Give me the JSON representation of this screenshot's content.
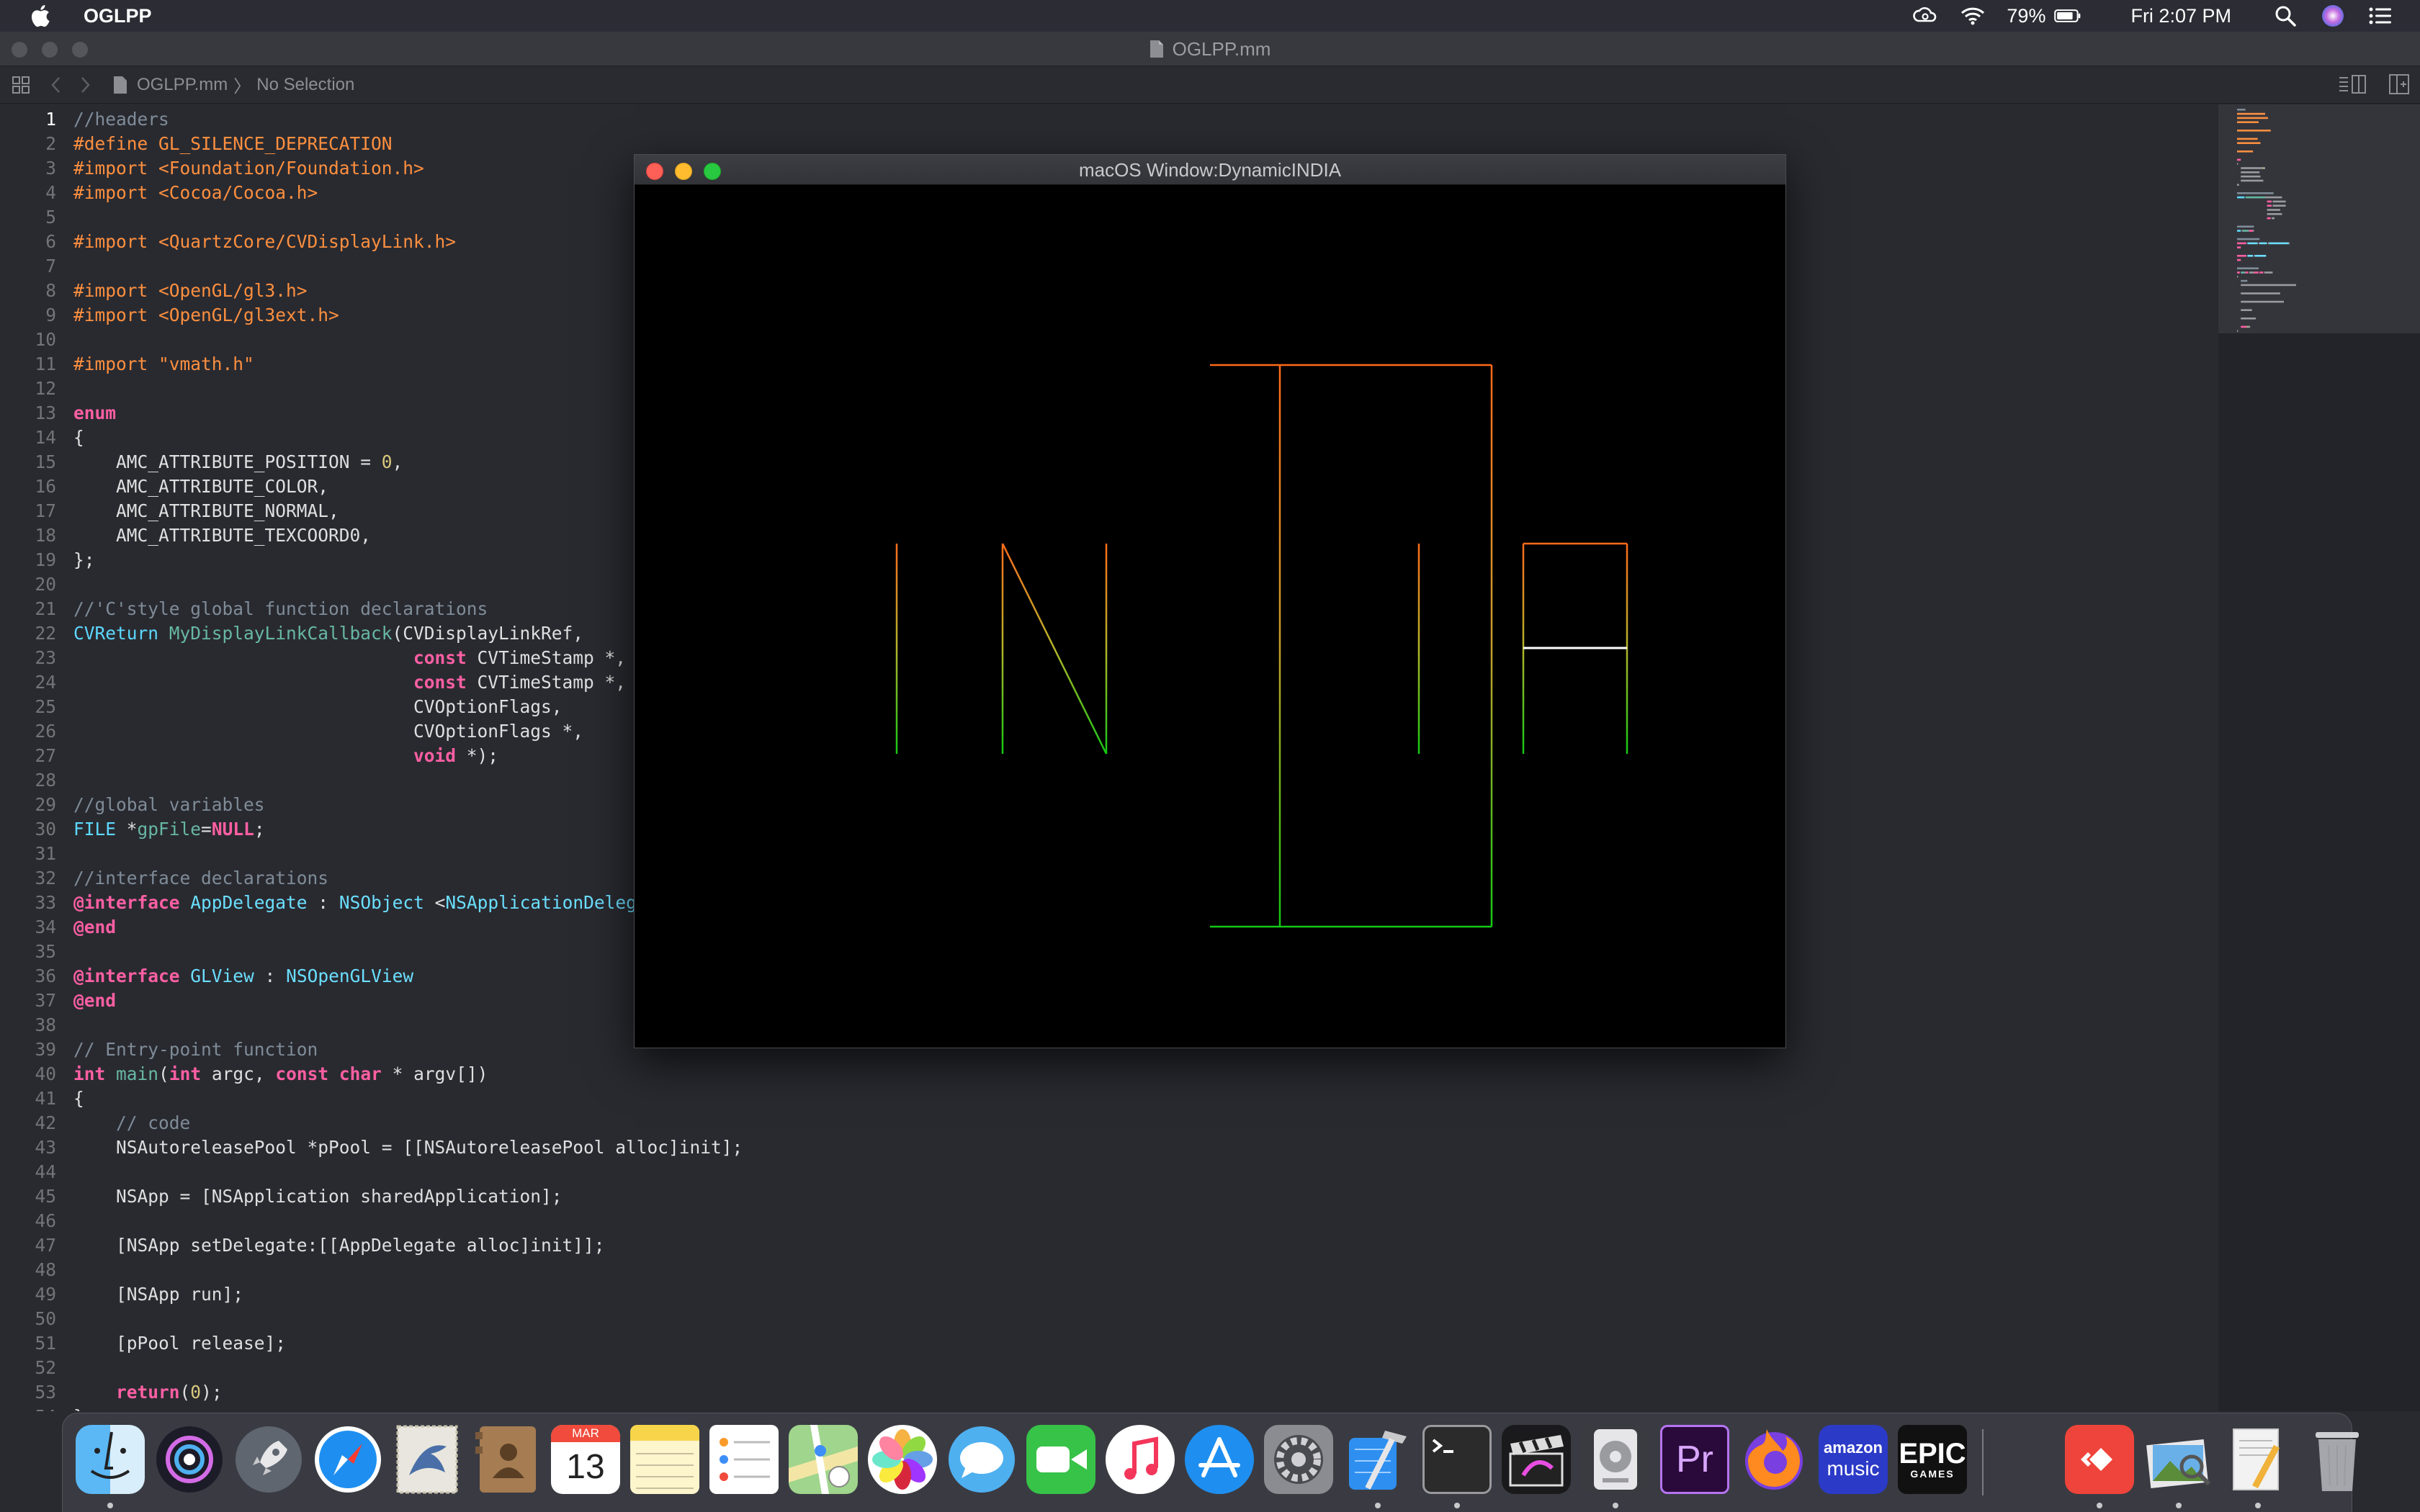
{
  "menubar": {
    "app_name": "OGLPP",
    "battery": "79%",
    "clock": "Fri 2:07 PM"
  },
  "xcode": {
    "window_title": "OGLPP.mm",
    "breadcrumb_file": "OGLPP.mm",
    "breadcrumb_selection": "No Selection",
    "current_line": 1
  },
  "editor": {
    "lines": [
      [
        [
          "cm",
          "//headers"
        ]
      ],
      [
        [
          "pp",
          "#define GL_SILENCE_DEPRECATION"
        ]
      ],
      [
        [
          "pp",
          "#import <Foundation/Foundation.h>"
        ]
      ],
      [
        [
          "pp",
          "#import <Cocoa/Cocoa.h>"
        ]
      ],
      [],
      [
        [
          "pp",
          "#import <QuartzCore/CVDisplayLink.h>"
        ]
      ],
      [],
      [
        [
          "pp",
          "#import <OpenGL/gl3.h>"
        ]
      ],
      [
        [
          "pp",
          "#import <OpenGL/gl3ext.h>"
        ]
      ],
      [],
      [
        [
          "pp",
          "#import \"vmath.h\""
        ]
      ],
      [],
      [
        [
          "kw",
          "enum"
        ]
      ],
      [
        [
          "",
          "{"
        ]
      ],
      [
        [
          "",
          "    AMC_ATTRIBUTE_POSITION = "
        ],
        [
          "nm",
          "0"
        ],
        [
          "",
          ","
        ]
      ],
      [
        [
          "",
          "    AMC_ATTRIBUTE_COLOR,"
        ]
      ],
      [
        [
          "",
          "    AMC_ATTRIBUTE_NORMAL,"
        ]
      ],
      [
        [
          "",
          "    AMC_ATTRIBUTE_TEXCOORD0,"
        ]
      ],
      [
        [
          "",
          "};"
        ]
      ],
      [],
      [
        [
          "cm",
          "//'C'style global function declarations"
        ]
      ],
      [
        [
          "ty",
          "CVReturn"
        ],
        [
          "",
          " "
        ],
        [
          "fn",
          "MyDisplayLinkCallback"
        ],
        [
          "",
          "(CVDisplayLinkRef,"
        ]
      ],
      [
        [
          "",
          "                                "
        ],
        [
          "kw",
          "const"
        ],
        [
          "",
          " CVTimeStamp *,"
        ]
      ],
      [
        [
          "",
          "                                "
        ],
        [
          "kw",
          "const"
        ],
        [
          "",
          " CVTimeStamp *,"
        ]
      ],
      [
        [
          "",
          "                                CVOptionFlags,"
        ]
      ],
      [
        [
          "",
          "                                CVOptionFlags *,"
        ]
      ],
      [
        [
          "",
          "                                "
        ],
        [
          "kw",
          "void"
        ],
        [
          "",
          " *);"
        ]
      ],
      [],
      [
        [
          "cm",
          "//global variables"
        ]
      ],
      [
        [
          "ty",
          "FILE"
        ],
        [
          "",
          " *"
        ],
        [
          "fn",
          "gpFile"
        ],
        [
          "",
          "="
        ],
        [
          "kw",
          "NULL"
        ],
        [
          "",
          ";"
        ]
      ],
      [],
      [
        [
          "cm",
          "//interface declarations"
        ]
      ],
      [
        [
          "kw",
          "@interface"
        ],
        [
          "",
          " "
        ],
        [
          "cls",
          "AppDelegate"
        ],
        [
          "",
          " : "
        ],
        [
          "cls",
          "NSObject"
        ],
        [
          "",
          " <"
        ],
        [
          "cls",
          "NSApplicationDelegate"
        ],
        [
          "",
          ">"
        ]
      ],
      [
        [
          "kw",
          "@end"
        ]
      ],
      [],
      [
        [
          "kw",
          "@interface"
        ],
        [
          "",
          " "
        ],
        [
          "cls",
          "GLView"
        ],
        [
          "",
          " : "
        ],
        [
          "cls",
          "NSOpenGLView"
        ]
      ],
      [
        [
          "kw",
          "@end"
        ]
      ],
      [],
      [
        [
          "cm",
          "// Entry-point function"
        ]
      ],
      [
        [
          "kw",
          "int"
        ],
        [
          "",
          " "
        ],
        [
          "fn",
          "main"
        ],
        [
          "",
          "("
        ],
        [
          "kw",
          "int"
        ],
        [
          "",
          " argc, "
        ],
        [
          "kw",
          "const"
        ],
        [
          "",
          " "
        ],
        [
          "kw",
          "char"
        ],
        [
          "",
          " * argv[])"
        ]
      ],
      [
        [
          "",
          "{"
        ]
      ],
      [
        [
          "",
          "    "
        ],
        [
          "cm",
          "// code"
        ]
      ],
      [
        [
          "",
          "    NSAutoreleasePool *pPool = [[NSAutoreleasePool alloc]init];"
        ]
      ],
      [],
      [
        [
          "",
          "    NSApp = [NSApplication sharedApplication];"
        ]
      ],
      [],
      [
        [
          "",
          "    [NSApp setDelegate:[[AppDelegate alloc]init]];"
        ]
      ],
      [],
      [
        [
          "",
          "    [NSApp run];"
        ]
      ],
      [],
      [
        [
          "",
          "    [pPool release];"
        ]
      ],
      [],
      [
        [
          "",
          "    "
        ],
        [
          "kw",
          "return"
        ],
        [
          "",
          "("
        ],
        [
          "nm",
          "0"
        ],
        [
          "",
          ");"
        ]
      ],
      [
        [
          "",
          "}"
        ]
      ]
    ]
  },
  "gl_window": {
    "title": "macOS Window:DynamicINDIA"
  },
  "dock": {
    "apps": [
      "Finder",
      "Siri",
      "Launchpad",
      "Safari",
      "Mail",
      "Contacts",
      "Calendar",
      "Notes",
      "Reminders",
      "Maps",
      "Photos",
      "Messages",
      "FaceTime",
      "Music",
      "App Store",
      "System Preferences",
      "Xcode",
      "Terminal",
      "Final Cut Pro",
      "Compressor",
      "Adobe Premiere Pro",
      "Firefox",
      "Amazon Music",
      "Epic Games",
      "AnyDesk",
      "Preview",
      "Instruments",
      "Trash"
    ],
    "calendar_month": "MAR",
    "calendar_day": "13",
    "premiere_label": "Pr",
    "amazon_label_1": "amazon",
    "amazon_label_2": "music",
    "epic_label_1": "EPIC",
    "epic_label_2": "GAMES"
  }
}
